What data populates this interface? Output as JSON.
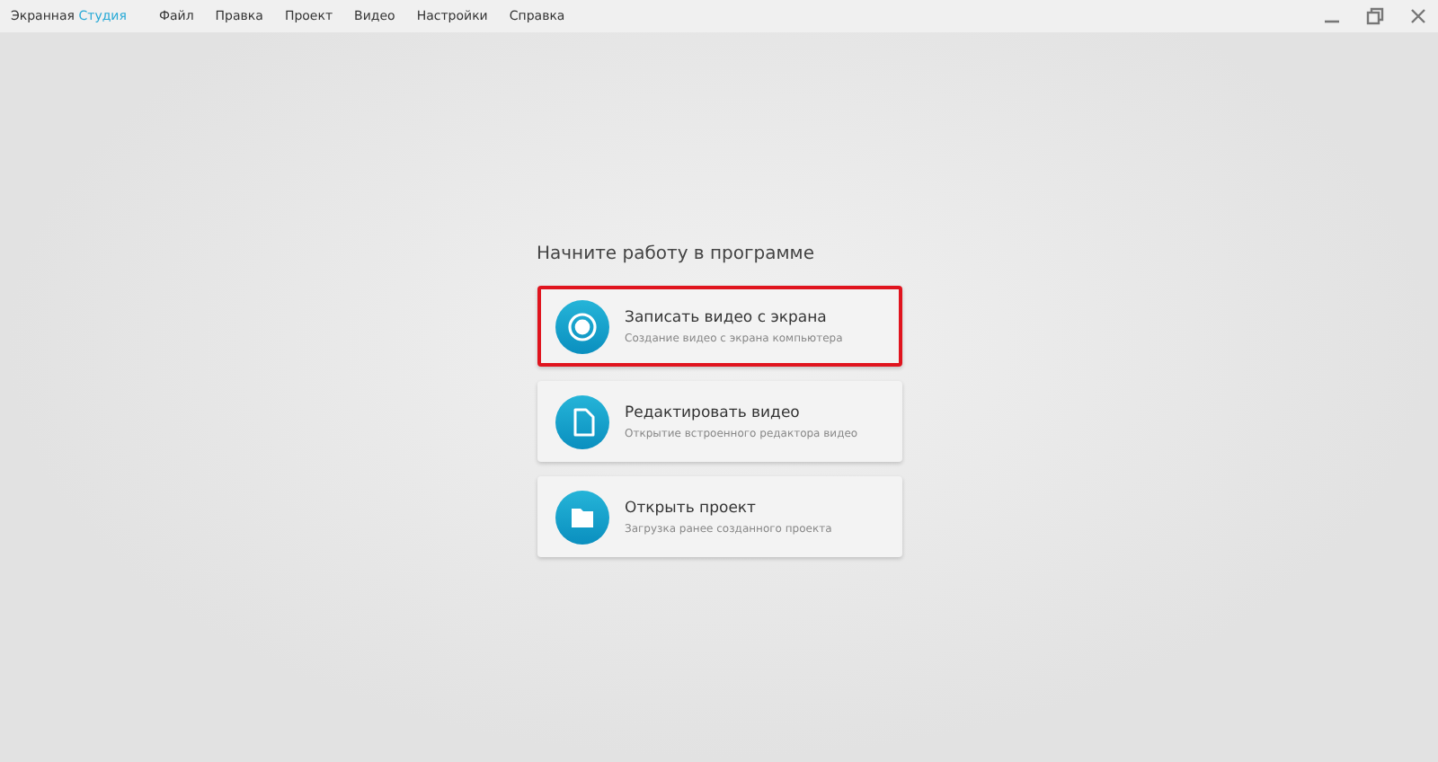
{
  "app_title": {
    "part_1": "Экранная",
    "part_2": "Студия"
  },
  "menu": [
    "Файл",
    "Правка",
    "Проект",
    "Видео",
    "Настройки",
    "Справка"
  ],
  "heading": "Начните работу в программе",
  "actions": [
    {
      "kind": "record",
      "title": "Записать видео с экрана",
      "subtitle": "Создание видео с экрана компьютера",
      "highlighted": true
    },
    {
      "kind": "edit",
      "title": "Редактировать видео",
      "subtitle": "Открытие встроенного редактора видео",
      "highlighted": false
    },
    {
      "kind": "open",
      "title": "Открыть проект",
      "subtitle": "Загрузка ранее созданного проекта",
      "highlighted": false
    }
  ]
}
